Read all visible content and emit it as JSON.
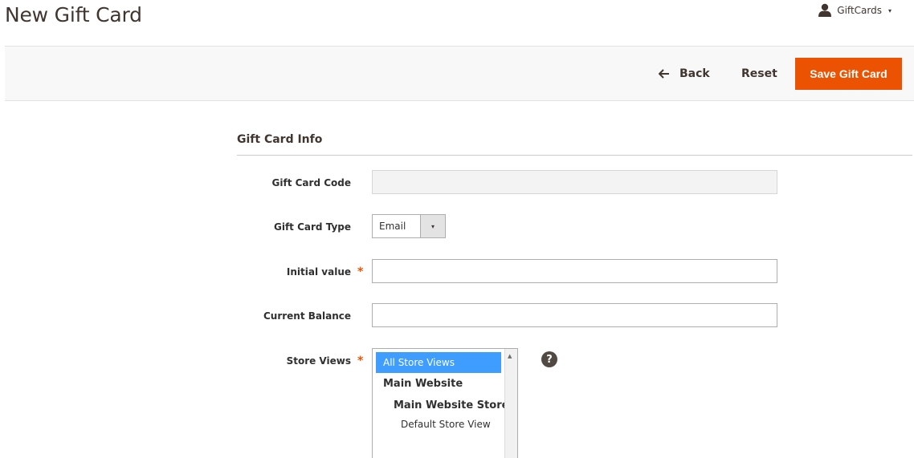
{
  "header": {
    "title": "New Gift Card",
    "user_label": "GiftCards",
    "user_icon": "user-icon",
    "caret": "▾"
  },
  "actions": {
    "back_label": "Back",
    "reset_label": "Reset",
    "save_label": "Save Gift Card"
  },
  "section": {
    "title": "Gift Card Info"
  },
  "form": {
    "code_label": "Gift Card Code",
    "code_value": "",
    "type_label": "Gift Card Type",
    "type_value": "Email",
    "initial_label": "Initial value",
    "initial_value": "",
    "balance_label": "Current Balance",
    "balance_value": "",
    "stores_label": "Store Views",
    "required_mark": "*",
    "store_options": {
      "all": "All Store Views",
      "website": "Main Website",
      "store": "Main Website Store",
      "view": "Default Store View"
    },
    "help": "?"
  },
  "colors": {
    "accent": "#eb5202",
    "selection": "#3e9dff"
  }
}
